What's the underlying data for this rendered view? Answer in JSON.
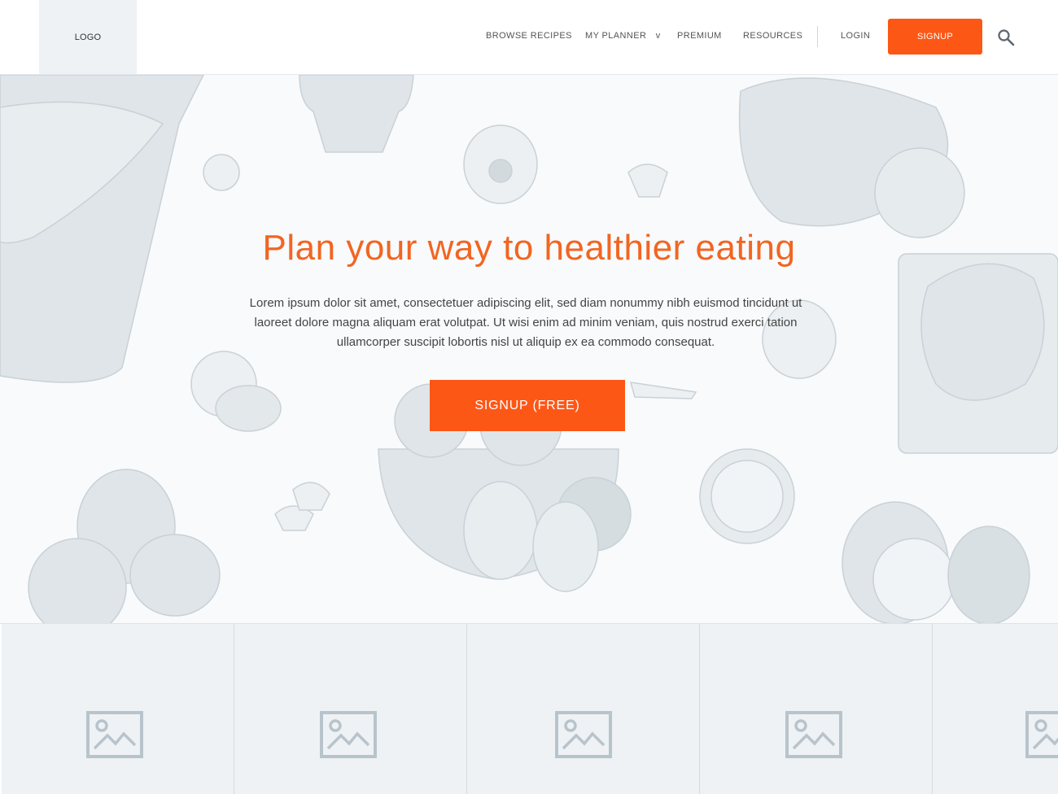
{
  "header": {
    "logo": "LOGO",
    "nav": {
      "browse": "BROWSE RECIPES",
      "planner": "MY PLANNER",
      "planner_caret": "v",
      "premium": "PREMIUM",
      "resources": "RESOURCES",
      "login": "LOGIN"
    },
    "signup_label": "SIGNUP",
    "search_icon": "search-icon"
  },
  "hero": {
    "title": "Plan your way to healthier eating",
    "body": "Lorem ipsum dolor sit amet, consectetuer adipiscing elit, sed diam nonummy nibh euismod tincidunt ut laoreet dolore magna aliquam erat volutpat. Ut wisi enim ad minim veniam, quis nostrud exerci tation ullamcorper suscipit lobortis nisl ut aliquip ex ea commodo consequat.",
    "cta_label": "SIGNUP (FREE)"
  },
  "grid": {
    "tile_icon": "image-placeholder-icon"
  },
  "colors": {
    "accent": "#fd5716",
    "title": "#f26522",
    "placeholder_bg": "#eef2f5",
    "placeholder_icon": "#b8c4cc"
  }
}
